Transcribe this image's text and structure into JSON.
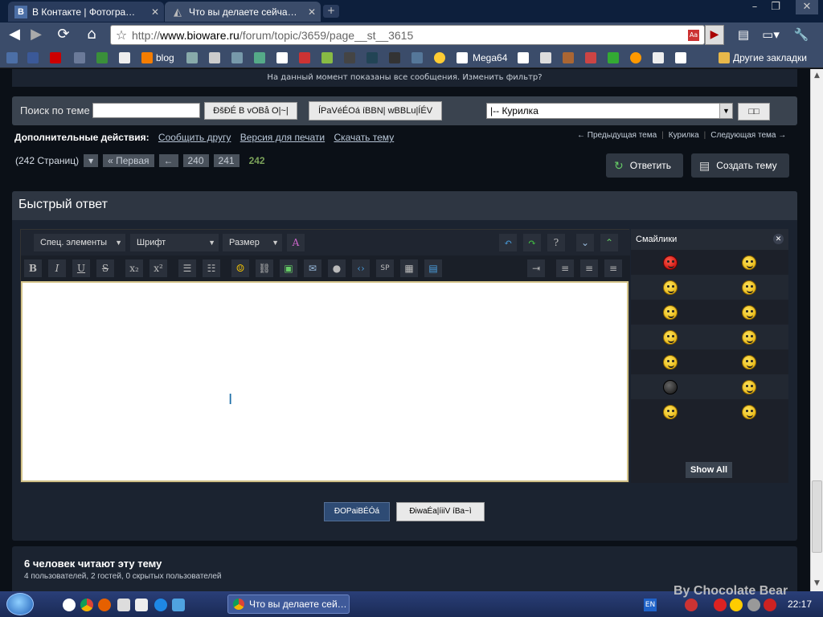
{
  "tabs": [
    {
      "title": "В Контакте | Фотогра…",
      "favicon": "B"
    },
    {
      "title": "Что вы делаете сейча…"
    }
  ],
  "window": {
    "minimize": "–",
    "maximize": "❐",
    "close": "✕"
  },
  "toolbar": {
    "url_prefix": "http://",
    "url_domain": "www.bioware.ru",
    "url_path": "/forum/topic/3659/page__st__3615"
  },
  "bookmarks": {
    "items": [
      "blog",
      "Mega64"
    ],
    "other": "Другие закладки"
  },
  "forum": {
    "filter_text": "На данный момент показаны все сообщения. Изменить фильтр?",
    "search_label": "Поиск по теме",
    "search_button": "ÐšÐÉ B vOBå O|~|",
    "search_forum_button": "ÍPaVéÉOá íBBN| wBBLu|ÍÉV",
    "forum_select_value": "|-- Курилка",
    "go_button": "□□",
    "actions_title": "Дополнительные действия:",
    "actions_links": [
      "Сообщить другу",
      "Версия для печати",
      "Скачать тему"
    ],
    "topic_nav": {
      "prev": "← Предыдущая тема",
      "forum": "Курилка",
      "next": "Следующая тема →"
    },
    "pages_total": "(242 Страниц)",
    "pages": {
      "first": "« Первая",
      "back": "←",
      "p1": "240",
      "p2": "241",
      "current": "242"
    },
    "reply_button": "Ответить",
    "new_topic_button": "Создать тему"
  },
  "quick_reply": {
    "title": "Быстрый ответ",
    "dropdowns": {
      "special": "Спец. элементы",
      "font": "Шрифт",
      "size": "Размер"
    },
    "buttons": {
      "bold": "B",
      "italic": "I",
      "underline": "U",
      "strike": "S",
      "sub": "x₂",
      "sup": "x²",
      "sp": "SP",
      "help": "?"
    },
    "smileys_title": "Смайлики",
    "show_all": "Show All",
    "submit_button": "ÐOPaiBÉÓá",
    "preview_button": "ÐiwaÉa|íiiV íBa~ì"
  },
  "readers": {
    "title": "6 человек читают эту тему",
    "subtitle": "4 пользователей, 2 гостей, 0 скрытых пользователей"
  },
  "taskbar": {
    "active_window": "Что вы делаете сей…",
    "lang": "EN",
    "clock": "22:17"
  },
  "watermark": "By Chocolate Bear",
  "colors": {
    "accent": "#2e4b74",
    "page_num_current": "#7ba25a",
    "panel": "#1b2330"
  }
}
